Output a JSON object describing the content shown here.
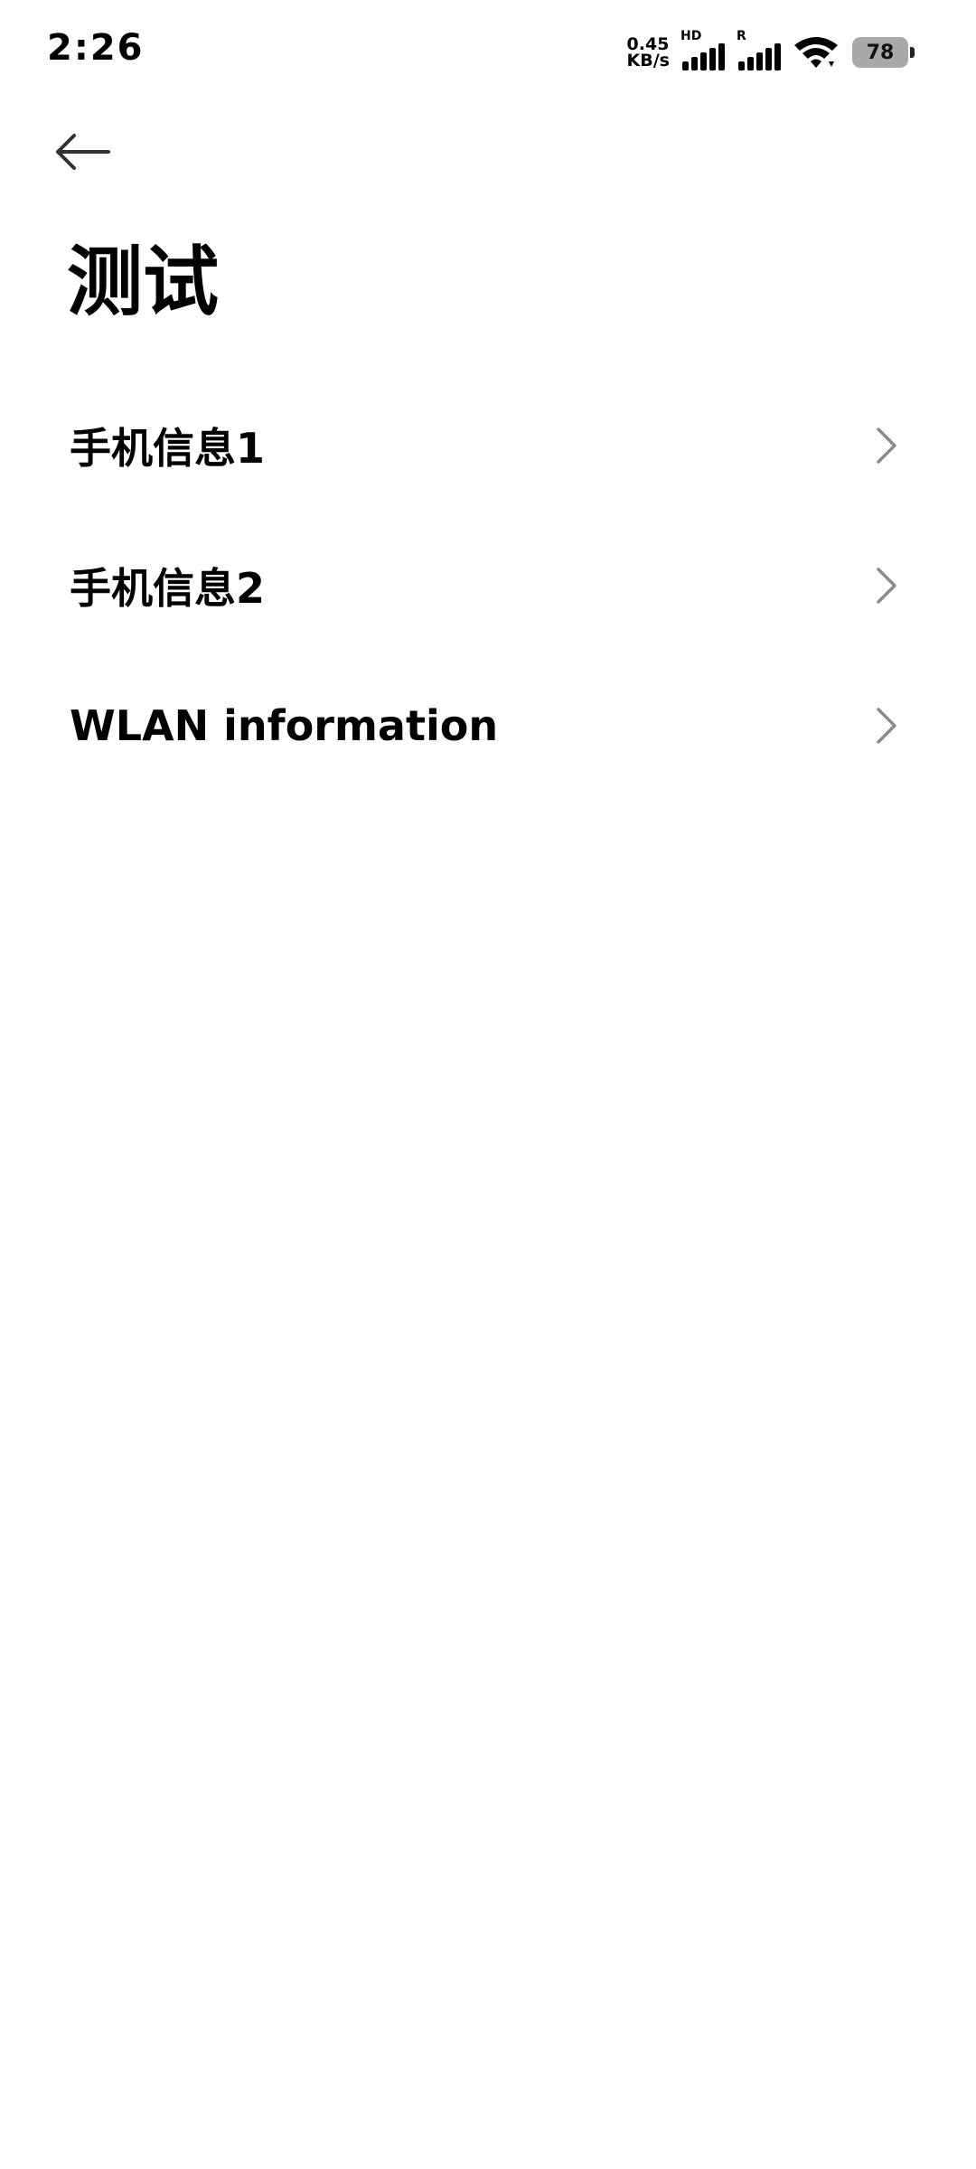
{
  "status_bar": {
    "time": "2:26",
    "net_speed_value": "0.45",
    "net_speed_unit": "KB/s",
    "sim1_tag": "HD",
    "sim2_tag": "R",
    "battery_level": "78"
  },
  "header": {
    "back_icon": "arrow-left-icon",
    "title": "测试"
  },
  "menu": {
    "items": [
      {
        "label": "手机信息1",
        "icon": "chevron-right-icon"
      },
      {
        "label": "手机信息2",
        "icon": "chevron-right-icon"
      },
      {
        "label": "WLAN information",
        "icon": "chevron-right-icon"
      }
    ]
  },
  "colors": {
    "background": "#ffffff",
    "text": "#000000",
    "chevron": "#8a8a8a",
    "battery_fill": "#a9a9a9"
  }
}
